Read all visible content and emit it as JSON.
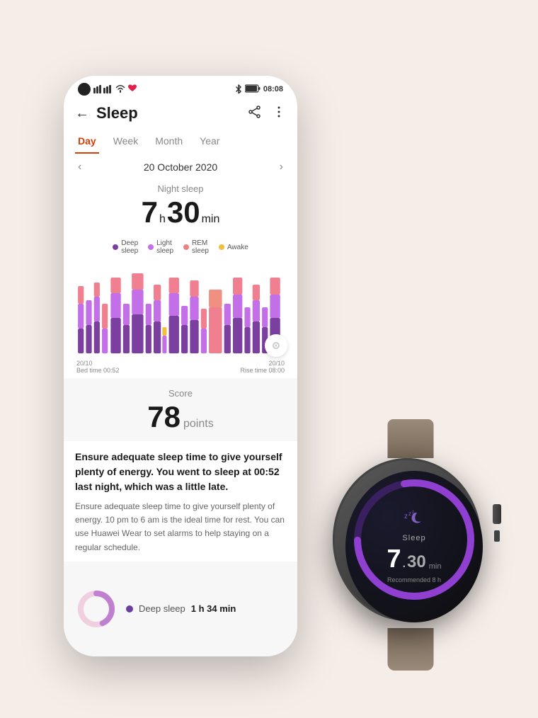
{
  "status_bar": {
    "signal": "4G 4G",
    "wifi": "WiFi",
    "time": "08:08",
    "bluetooth": "BT",
    "battery": "Battery"
  },
  "header": {
    "back_label": "←",
    "title": "Sleep",
    "share_icon": "share",
    "more_icon": "more"
  },
  "tabs": [
    {
      "label": "Day",
      "active": true
    },
    {
      "label": "Week",
      "active": false
    },
    {
      "label": "Month",
      "active": false
    },
    {
      "label": "Year",
      "active": false
    }
  ],
  "date_nav": {
    "prev": "‹",
    "next": "›",
    "date": "20 October 2020"
  },
  "sleep_summary": {
    "label": "Night sleep",
    "hours": "7",
    "hours_unit": "h",
    "minutes": "30",
    "minutes_unit": "min"
  },
  "legend": [
    {
      "label": "Deep sleep",
      "color": "#7b3fa0"
    },
    {
      "label": "Light sleep",
      "color": "#c370e8"
    },
    {
      "label": "REM sleep",
      "color": "#f08080"
    },
    {
      "label": "Awake",
      "color": "#f0c040"
    }
  ],
  "chart": {
    "left_label": "20/10\nBed time 00:52",
    "right_label": "20/10\nRise time 08:00"
  },
  "score": {
    "label": "Score",
    "value": "78",
    "unit": "points"
  },
  "message_bold": "Ensure adequate sleep time to give yourself plenty of energy. You went to sleep at 00:52 last night, which was a little late.",
  "message_normal": "Ensure adequate sleep time to give yourself plenty of energy. 10 pm to 6 am is the ideal time for rest. You can use Huawei Wear to set alarms to help staying on a regular schedule.",
  "deep_sleep": {
    "label": "Deep sleep",
    "duration": "1 h 34 min",
    "color": "#6b3fa0"
  },
  "watch": {
    "sleep_label": "Sleep",
    "hours": "7",
    "dot": ".",
    "minutes": "30",
    "minutes_unit": "min",
    "recommended_label": "Recommended 8 h"
  }
}
